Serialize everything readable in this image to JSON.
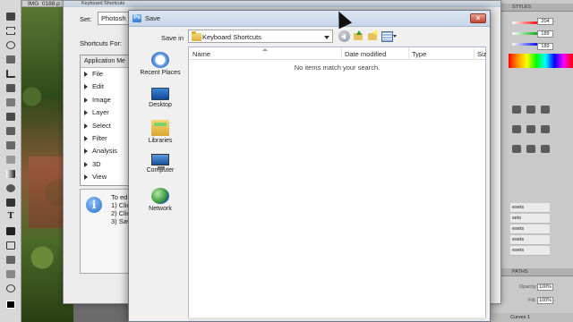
{
  "photoshop": {
    "document_tab": "IMG_0188.p",
    "panels": {
      "styles_label": "STYLES",
      "color_values": [
        "204",
        "189",
        "189"
      ],
      "presets": [
        "esets",
        "sets",
        "esets",
        "esets",
        "esets"
      ],
      "paths_label": "PATHS",
      "opacity_label": "Opacity:",
      "opacity_value": "100%",
      "fill_label": "Fill:",
      "fill_value": "100%",
      "layer_name": "Curves 1"
    }
  },
  "keyboard_dialog": {
    "title": "Keyboard Shortcuts",
    "set_label": "Set:",
    "set_value": "Photosh",
    "shortcuts_for_label": "Shortcuts For:",
    "column_header": "Application Me",
    "items": [
      "File",
      "Edit",
      "Image",
      "Layer",
      "Select",
      "Filter",
      "Analysis",
      "3D",
      "View"
    ],
    "info_text": "To ed\n1) Clic\n2) Clic\n3) Sav"
  },
  "save_dialog": {
    "title": "Save",
    "save_in_label": "Save in",
    "save_in_value": "Keyboard Shortcuts",
    "places": [
      {
        "label": "Recent Places",
        "icon": "recent-places-icon"
      },
      {
        "label": "Desktop",
        "icon": "desktop-icon"
      },
      {
        "label": "Libraries",
        "icon": "libraries-icon"
      },
      {
        "label": "Computer",
        "icon": "computer-icon"
      },
      {
        "label": "Network",
        "icon": "network-icon"
      }
    ],
    "columns": [
      "Name",
      "Date modified",
      "Type",
      "Siz"
    ],
    "empty_message": "No items match your search."
  }
}
